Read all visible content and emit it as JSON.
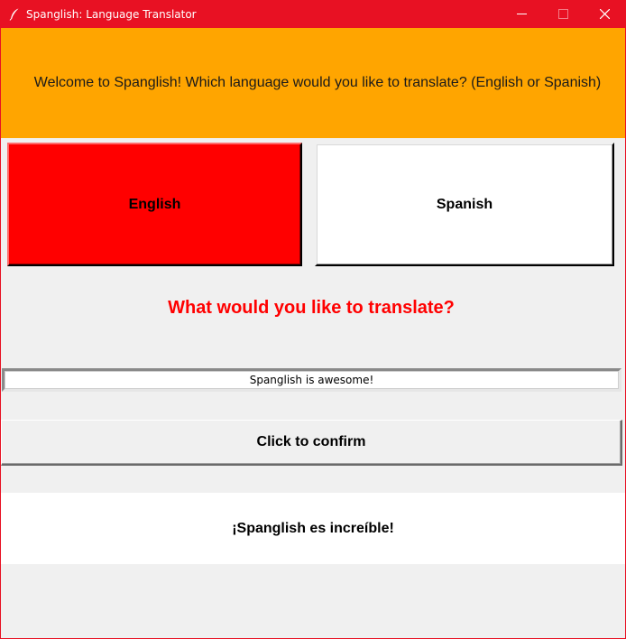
{
  "window": {
    "title": "Spanglish: Language Translator",
    "accent_color": "#e81123",
    "icon": "feather-icon",
    "controls": [
      "minimize-icon",
      "maximize-icon",
      "close-icon"
    ]
  },
  "banner": {
    "text": "Welcome to Spanglish! Which language would you like to translate? (English or Spanish)",
    "background": "#ffa500"
  },
  "languages": {
    "english_label": "English",
    "spanish_label": "Spanish",
    "selected": "English",
    "selected_color": "#ff0000"
  },
  "prompt": {
    "text": "What would you like to translate?",
    "color": "#ff0000"
  },
  "input": {
    "value": "Spanglish is awesome!"
  },
  "confirm": {
    "label": "Click to confirm"
  },
  "result": {
    "text": "¡Spanglish es increíble!"
  }
}
